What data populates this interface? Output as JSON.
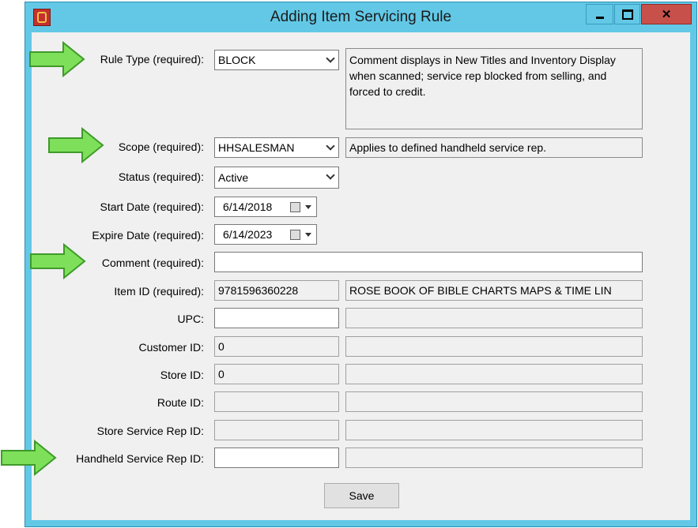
{
  "window": {
    "title": "Adding Item Servicing Rule"
  },
  "form": {
    "rule_type": {
      "label": "Rule Type (required):",
      "value": "BLOCK",
      "description": "Comment displays in New Titles and Inventory Display when scanned; service rep blocked from selling, and forced to credit."
    },
    "scope": {
      "label": "Scope (required):",
      "value": "HHSALESMAN",
      "description": "Applies to defined handheld service rep."
    },
    "status": {
      "label": "Status (required):",
      "value": "Active"
    },
    "start_date": {
      "label": "Start Date (required):",
      "value": "6/14/2018"
    },
    "expire_date": {
      "label": "Expire Date (required):",
      "value": "6/14/2023"
    },
    "comment": {
      "label": "Comment (required):",
      "value": ""
    },
    "item_id": {
      "label": "Item ID (required):",
      "value": "9781596360228",
      "description": "ROSE BOOK OF BIBLE CHARTS MAPS & TIME LIN"
    },
    "upc": {
      "label": "UPC:",
      "value": "",
      "description": ""
    },
    "customer_id": {
      "label": "Customer ID:",
      "value": "0",
      "description": ""
    },
    "store_id": {
      "label": "Store ID:",
      "value": "0",
      "description": ""
    },
    "route_id": {
      "label": "Route ID:",
      "value": "",
      "description": ""
    },
    "store_service_rep_id": {
      "label": "Store Service Rep ID:",
      "value": "",
      "description": ""
    },
    "handheld_service_rep_id": {
      "label": "Handheld Service Rep ID:",
      "value": "",
      "description": ""
    }
  },
  "buttons": {
    "save": "Save"
  },
  "annotation": {
    "arrow_color": "#7ee05a"
  },
  "icons": [
    "app-icon",
    "minimize-icon",
    "maximize-icon",
    "close-icon",
    "calendar-icon",
    "chevron-down-icon",
    "arrow-annotation-icon"
  ]
}
